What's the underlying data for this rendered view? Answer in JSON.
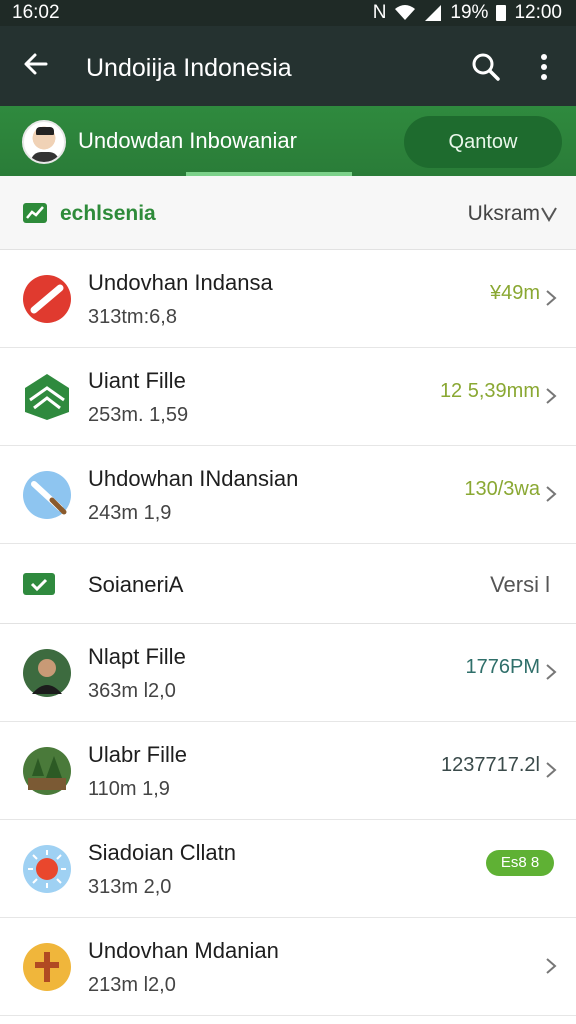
{
  "status": {
    "time": "16:02",
    "battery": "19%",
    "clock": "12:00"
  },
  "appbar": {
    "title": "Undoiija Indonesia"
  },
  "profile": {
    "name": "Undowdan Inbowaniar",
    "action_label": "Qantow"
  },
  "subheader": {
    "label": "echlsenia",
    "sort_label": "Uksram"
  },
  "rows_top": [
    {
      "title": "Undovhan Indansa",
      "subtitle": "313tm:6,8",
      "meta": "¥49m",
      "icon": "no-entry-icon",
      "meta_color": "#8aa833"
    },
    {
      "title": "Uiant Fille",
      "subtitle": "253m. 1,59",
      "meta": "12 5,39mm",
      "icon": "mail-icon",
      "meta_color": "#8aa833"
    },
    {
      "title": "Uhdowhan INdansian",
      "subtitle": "243m 1,9",
      "meta": "130/3wa",
      "icon": "paintbrush-icon",
      "meta_color": "#8aa833"
    }
  ],
  "section": {
    "label": "SoianeriA",
    "right": "Versi l"
  },
  "rows_bottom": [
    {
      "title": "Nlapt Fille",
      "subtitle": "363m l2,0",
      "meta": "1776PM",
      "icon": "person-photo-icon",
      "meta_color": "#2f6f6a"
    },
    {
      "title": "Ulabr Fille",
      "subtitle": "110m 1,9",
      "meta": "1237717.2l",
      "icon": "forest-photo-icon",
      "meta_color": "#3a4a4a"
    },
    {
      "title": "Siadoian Cllatn",
      "subtitle": "313m 2,0",
      "badge": "Es8 8",
      "icon": "sun-icon"
    },
    {
      "title": "Undovhan Mdanian",
      "subtitle": "213m l2,0",
      "icon": "tools-icon"
    }
  ]
}
